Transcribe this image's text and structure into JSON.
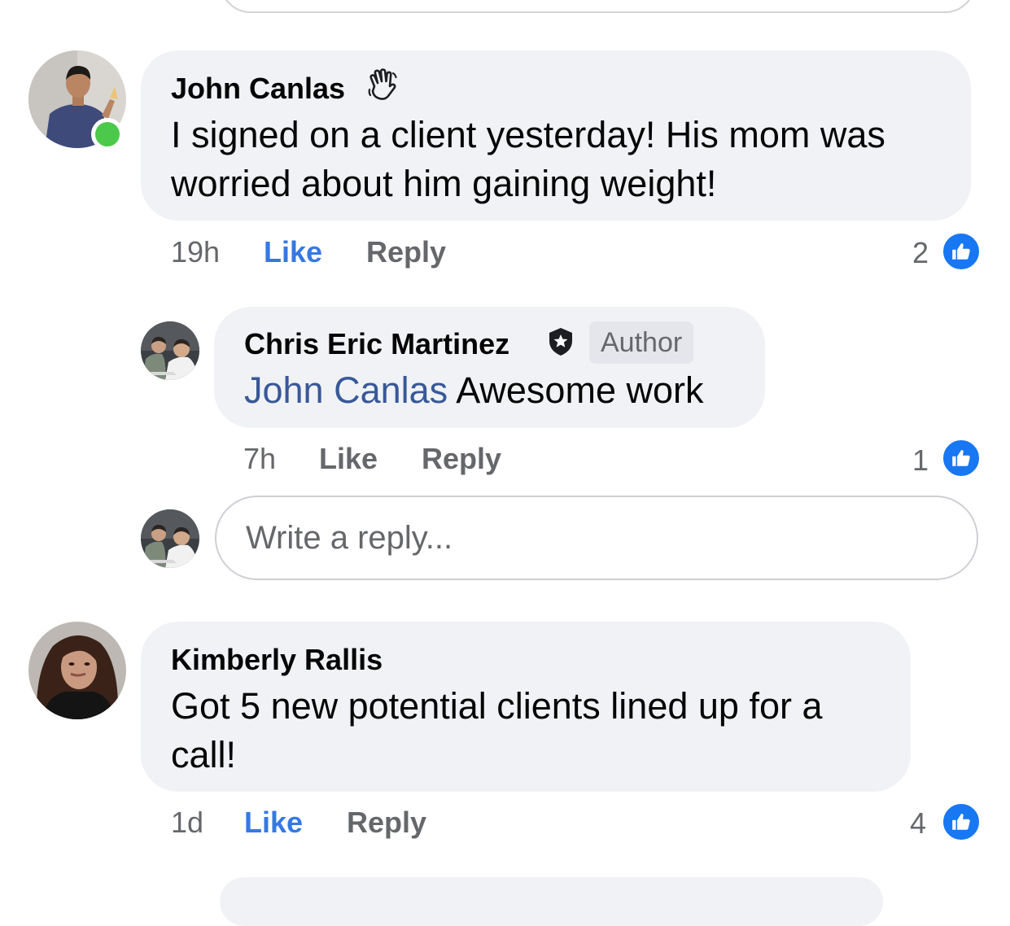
{
  "comments": [
    {
      "name": "John Canlas",
      "badge_icon": "waving-hand-icon",
      "online": true,
      "text": "I signed on a client yesterday! His mom was worried about him gaining weight!",
      "time": "19h",
      "like_label": "Like",
      "reply_label": "Reply",
      "reaction_count": "2",
      "liked": true
    },
    {
      "name": "Kimberly Rallis",
      "text": "Got 5 new potential clients lined up for a call!",
      "time": "1d",
      "like_label": "Like",
      "reply_label": "Reply",
      "reaction_count": "4",
      "liked": true
    }
  ],
  "reply": {
    "name": "Chris Eric Martinez",
    "badge_icon": "shield-star-icon",
    "author_label": "Author",
    "mention": "John Canlas",
    "text": "Awesome work",
    "time": "7h",
    "like_label": "Like",
    "reply_label": "Reply",
    "reaction_count": "1",
    "liked": false
  },
  "reply_box": {
    "placeholder": "Write a reply..."
  },
  "colors": {
    "like_active": "#3578e5",
    "bubble": "#f0f2f5",
    "muted": "#65676b",
    "mention": "#385898",
    "online": "#4cc94b"
  }
}
